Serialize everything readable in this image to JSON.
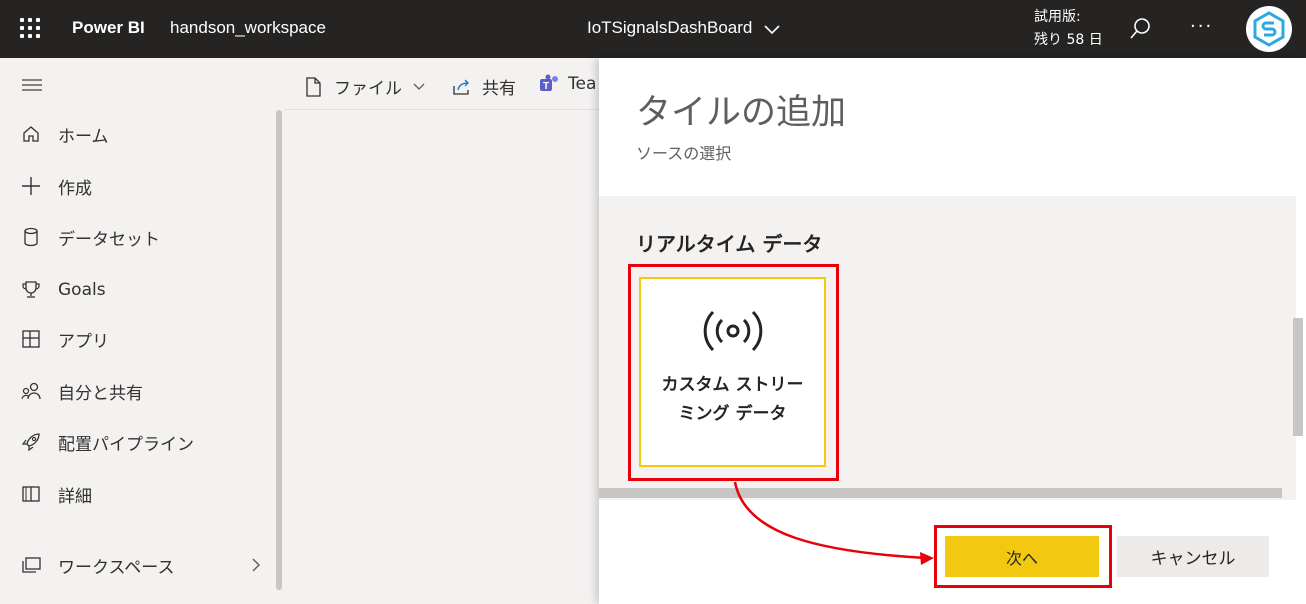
{
  "topbar": {
    "brand": "Power BI",
    "workspace": "handson_workspace",
    "dashboard_title": "IoTSignalsDashBoard",
    "trial_line1": "試用版:",
    "trial_line2": "残り 58 日"
  },
  "sidebar": {
    "items": [
      {
        "label": "ホーム",
        "icon": "home-icon"
      },
      {
        "label": "作成",
        "icon": "plus-icon"
      },
      {
        "label": "データセット",
        "icon": "database-icon"
      },
      {
        "label": "Goals",
        "icon": "trophy-icon"
      },
      {
        "label": "アプリ",
        "icon": "apps-icon"
      },
      {
        "label": "自分と共有",
        "icon": "people-icon"
      },
      {
        "label": "配置パイプライン",
        "icon": "rocket-icon"
      },
      {
        "label": "詳細",
        "icon": "book-icon"
      },
      {
        "label": "ワークスペース",
        "icon": "workspaces-icon"
      }
    ]
  },
  "commandbar": {
    "file": "ファイル",
    "share": "共有",
    "teams": "Tea"
  },
  "panel": {
    "title": "タイルの追加",
    "subtitle": "ソースの選択",
    "section_title": "リアルタイム データ",
    "tile_label": "カスタム ストリーミング データ",
    "tile_icon": "broadcast-icon",
    "next_label": "次へ",
    "cancel_label": "キャンセル"
  },
  "colors": {
    "topbar": "#252423",
    "accent": "#f2c811",
    "highlight": "#e8000b"
  }
}
